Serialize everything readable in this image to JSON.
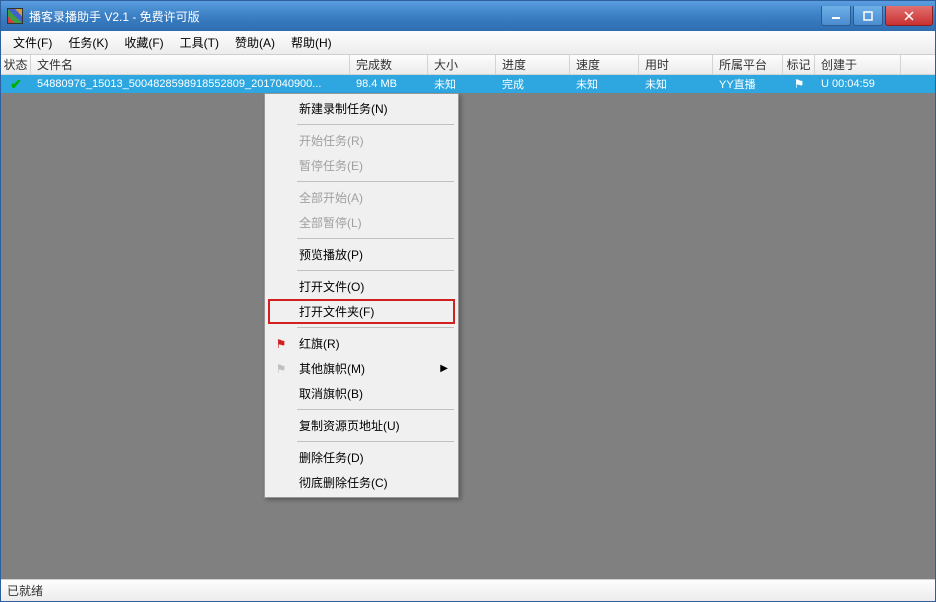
{
  "window": {
    "title": "播客录播助手 V2.1 - 免费许可版"
  },
  "menubar": {
    "file": "文件(F)",
    "tasks": "任务(K)",
    "favorites": "收藏(F)",
    "tools": "工具(T)",
    "sponsor": "赞助(A)",
    "help": "帮助(H)"
  },
  "columns": {
    "status": "状态",
    "filename": "文件名",
    "completed": "完成数",
    "size": "大小",
    "progress": "进度",
    "speed": "速度",
    "time": "用时",
    "platform": "所属平台",
    "mark": "标记",
    "created": "创建于"
  },
  "row": {
    "filename": "54880976_15013_5004828598918552809_2017040900...",
    "completed": "98.4 MB",
    "size": "未知",
    "progress": "完成",
    "speed": "未知",
    "time": "未知",
    "platform": "YY直播",
    "created": "U 00:04:59"
  },
  "contextMenu": {
    "newTask": "新建录制任务(N)",
    "startTask": "开始任务(R)",
    "pauseTask": "暂停任务(E)",
    "startAll": "全部开始(A)",
    "pauseAll": "全部暂停(L)",
    "previewPlay": "预览播放(P)",
    "openFile": "打开文件(O)",
    "openFolder": "打开文件夹(F)",
    "redFlag": "红旗(R)",
    "otherFlags": "其他旗帜(M)",
    "clearFlag": "取消旗帜(B)",
    "copyUrl": "复制资源页地址(U)",
    "deleteTask": "删除任务(D)",
    "purgeTask": "彻底删除任务(C)"
  },
  "statusbar": {
    "text": "已就绪"
  }
}
